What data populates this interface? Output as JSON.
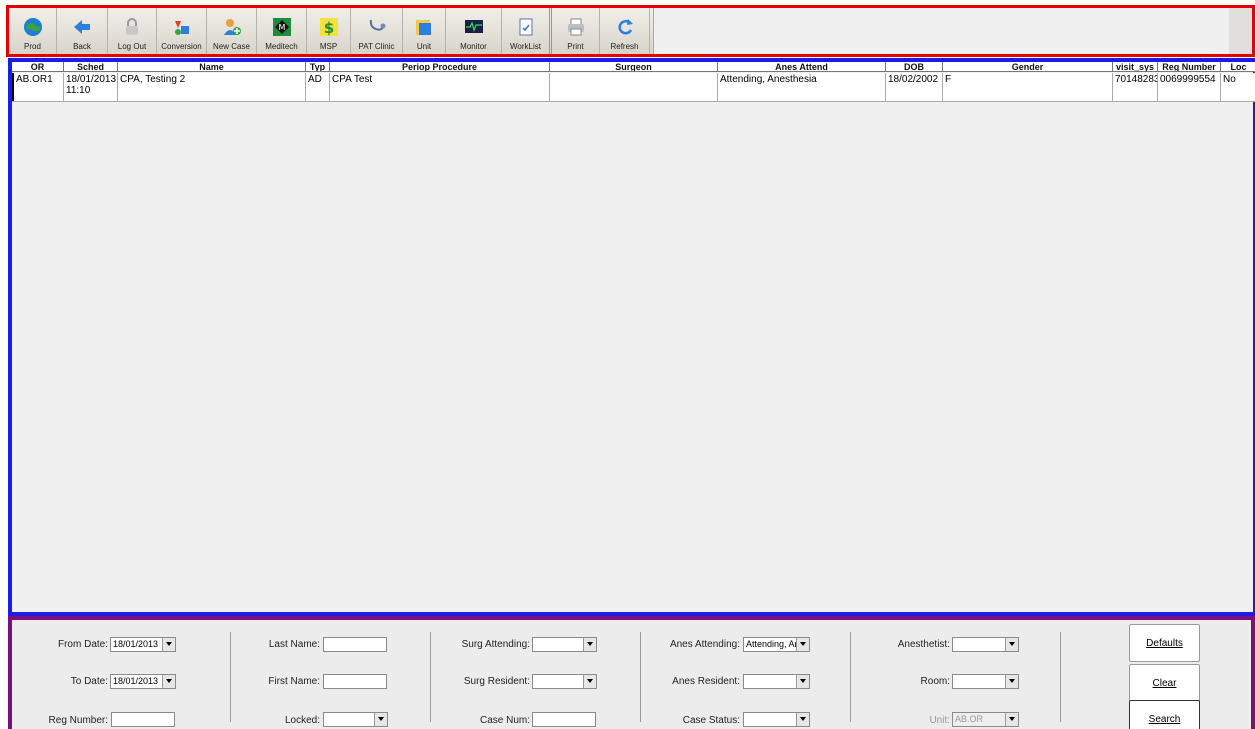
{
  "toolbar": {
    "buttons": [
      {
        "label": "Prod",
        "icon": "globe-icon"
      },
      {
        "label": "Back",
        "icon": "back-arrow-icon"
      },
      {
        "label": "Log Out",
        "icon": "lock-icon"
      },
      {
        "label": "Conversion",
        "icon": "conversion-icon"
      },
      {
        "label": "New Case",
        "icon": "new-case-icon"
      },
      {
        "label": "Meditech",
        "icon": "meditech-icon"
      },
      {
        "label": "MSP",
        "icon": "dollar-icon"
      },
      {
        "label": "PAT Clinic",
        "icon": "stethoscope-icon"
      },
      {
        "label": "Unit",
        "icon": "unit-icon"
      },
      {
        "label": "Monitor",
        "icon": "monitor-icon"
      },
      {
        "label": "WorkList",
        "icon": "worklist-icon"
      },
      {
        "label": "Print",
        "icon": "printer-icon"
      },
      {
        "label": "Refresh",
        "icon": "refresh-icon"
      }
    ]
  },
  "grid": {
    "columns": [
      "OR",
      "Sched",
      "Name",
      "Typ",
      "Periop Procedure",
      "Surgeon",
      "Anes Attend",
      "DOB",
      "Gender",
      "visit_sys",
      "Reg Number",
      "Loc"
    ],
    "rows": [
      {
        "or": "AB.OR1",
        "sched": "18/01/2013 11:10",
        "name": "CPA, Testing 2",
        "typ": "AD",
        "procedure": "CPA Test",
        "surgeon": "",
        "anes_attend": "Attending, Anesthesia",
        "dob": "18/02/2002",
        "gender": "F",
        "visit_sys": "70148283",
        "reg_number": "0069999554",
        "loc": "No"
      }
    ]
  },
  "filters": {
    "from_date_label": "From Date:",
    "from_date": "18/01/2013",
    "to_date_label": "To Date:",
    "to_date": "18/01/2013",
    "reg_number_label": "Reg Number:",
    "reg_number": "",
    "last_name_label": "Last Name:",
    "last_name": "",
    "first_name_label": "First Name:",
    "first_name": "",
    "locked_label": "Locked:",
    "locked": "",
    "surg_attending_label": "Surg Attending:",
    "surg_attending": "",
    "surg_resident_label": "Surg Resident:",
    "surg_resident": "",
    "case_num_label": "Case Num:",
    "case_num": "",
    "anes_attending_label": "Anes Attending:",
    "anes_attending": "Attending, Ar",
    "anes_resident_label": "Anes Resident:",
    "anes_resident": "",
    "case_status_label": "Case Status:",
    "case_status": "",
    "anesthetist_label": "Anesthetist:",
    "anesthetist": "",
    "room_label": "Room:",
    "room": "",
    "unit_label": "Unit:",
    "unit": "AB.OR",
    "defaults_label": "Defaults",
    "clear_label": "Clear",
    "search_label": "Search"
  }
}
